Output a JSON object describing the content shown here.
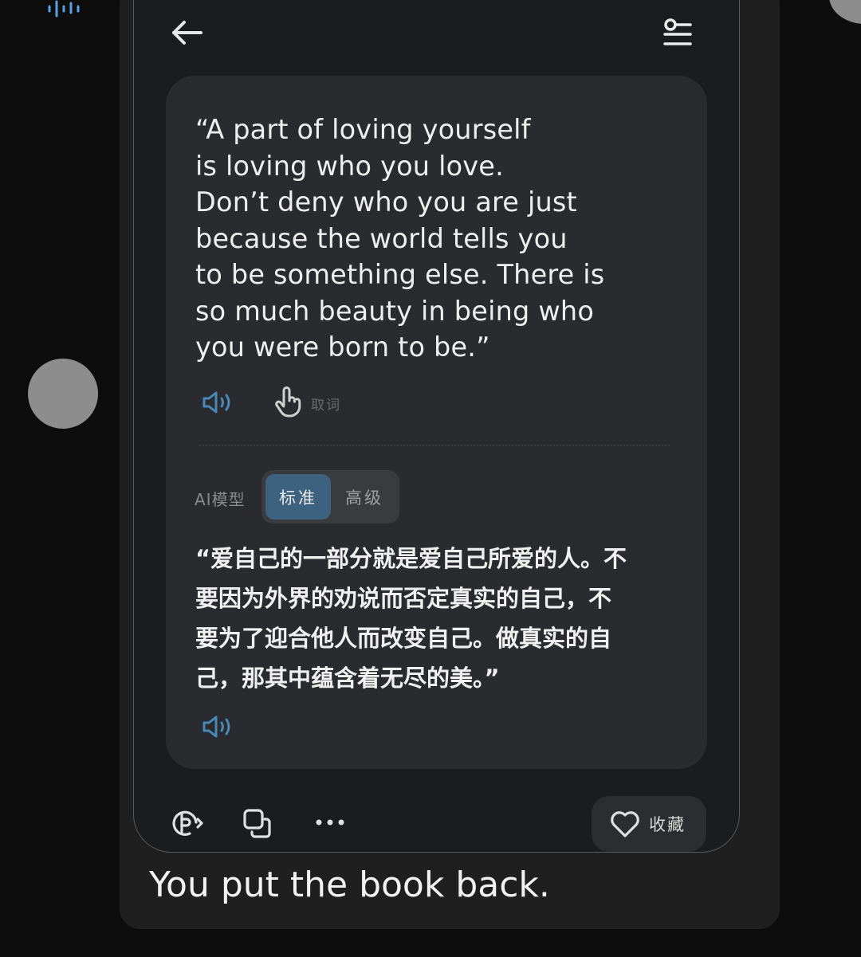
{
  "quote_en": "“A part of loving yourself\nis loving who you love.\nDon’t deny who you are just\nbecause the world tells you\nto be something else. There is\nso much beauty in being who\nyou were born to be.”",
  "lookup_label": "取词",
  "model": {
    "label": "AI模型",
    "options": [
      "标准",
      "高级"
    ],
    "selected": "标准"
  },
  "quote_zh": "“爱自己的一部分就是爱自己所爱的人。不\n要因为外界的劝说而否定真实的自己，不\n要为了迎合他人而改变自己。做真实的自\n己，那其中蕴含着无尽的美。”",
  "favorite_label": "收藏",
  "caption": "You put the book back.",
  "icons": {
    "back": "arrow-left-icon",
    "settings": "settings-toggle-icon",
    "speaker": "speaker-icon",
    "lookup": "hand-pointer-icon",
    "share": "share-icon",
    "copy": "copy-icon",
    "more": "more-icon",
    "heart": "heart-icon",
    "waveform": "waveform-icon"
  },
  "colors": {
    "accent": "#3d6280",
    "speaker_icon": "#4a88b8",
    "background": "#0d0d0d",
    "card": "#2a2b2e"
  }
}
